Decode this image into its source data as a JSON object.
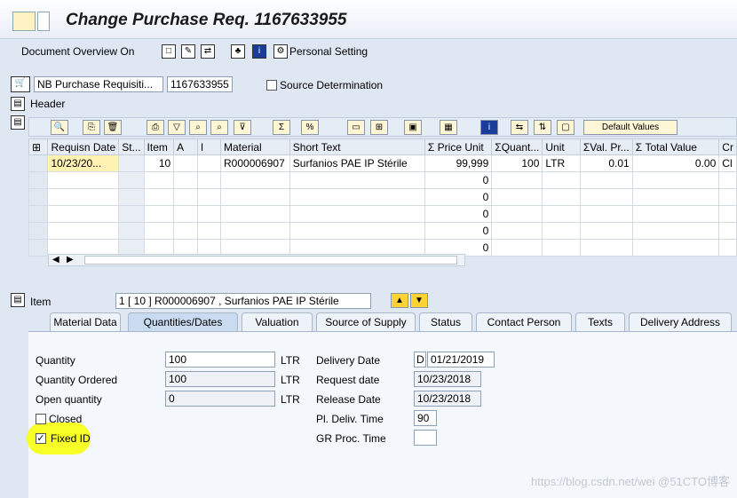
{
  "window": {
    "title": "Change Purchase Req. 1167633955"
  },
  "toolbar": {
    "doc_overview": "Document Overview On",
    "personal_setting": "Personal Setting"
  },
  "header": {
    "doc_type": "NB Purchase Requisiti...",
    "doc_number": "1167633955",
    "source_determination": "Source Determination",
    "header_label": "Header"
  },
  "grid": {
    "default_values_label": "Default Values",
    "columns": [
      "Requisn Date",
      "St...",
      "Item",
      "A",
      "I",
      "Material",
      "Short Text",
      "Σ  Price Unit",
      "ΣQuant...",
      "Unit",
      "ΣVal. Pr...",
      "Σ  Total Value",
      "Cr"
    ],
    "row1": {
      "date": "10/23/20...",
      "item": "10",
      "material": "R000006907",
      "short_text": "Surfanios PAE IP Stérile",
      "price": "99,999",
      "qty": "100",
      "unit": "LTR",
      "valpr": "0.01",
      "total": "0.00",
      "cr": "Cl"
    },
    "empty_prices": [
      "0",
      "0",
      "0",
      "0",
      "0"
    ]
  },
  "item": {
    "label": "Item",
    "selector": "1 [ 10 ] R000006907 , Surfanios PAE IP Stérile"
  },
  "tabs": [
    "Material Data",
    "Quantities/Dates",
    "Valuation",
    "Source of Supply",
    "Status",
    "Contact Person",
    "Texts",
    "Delivery Address"
  ],
  "quantities": {
    "quantity_label": "Quantity",
    "quantity": "100",
    "quantity_unit": "LTR",
    "qty_ordered_label": "Quantity Ordered",
    "qty_ordered": "100",
    "qty_ordered_unit": "LTR",
    "open_qty_label": "Open quantity",
    "open_qty": "0",
    "open_qty_unit": "LTR",
    "closed_label": "Closed",
    "fixed_id_label": "Fixed ID",
    "delivery_date_label": "Delivery Date",
    "delivery_date_type": "D",
    "delivery_date": "01/21/2019",
    "request_date_label": "Request date",
    "request_date": "10/23/2018",
    "release_date_label": "Release Date",
    "release_date": "10/23/2018",
    "pl_deliv_label": "Pl. Deliv. Time",
    "pl_deliv": "90",
    "gr_proc_label": "GR Proc. Time",
    "gr_proc": ""
  },
  "watermark": "https://blog.csdn.net/wei @51CTO博客",
  "colors": {
    "highlight": "#f5ff1a",
    "active_tab": "#c9dbf0",
    "cell_yellow": "#fff2b3"
  }
}
